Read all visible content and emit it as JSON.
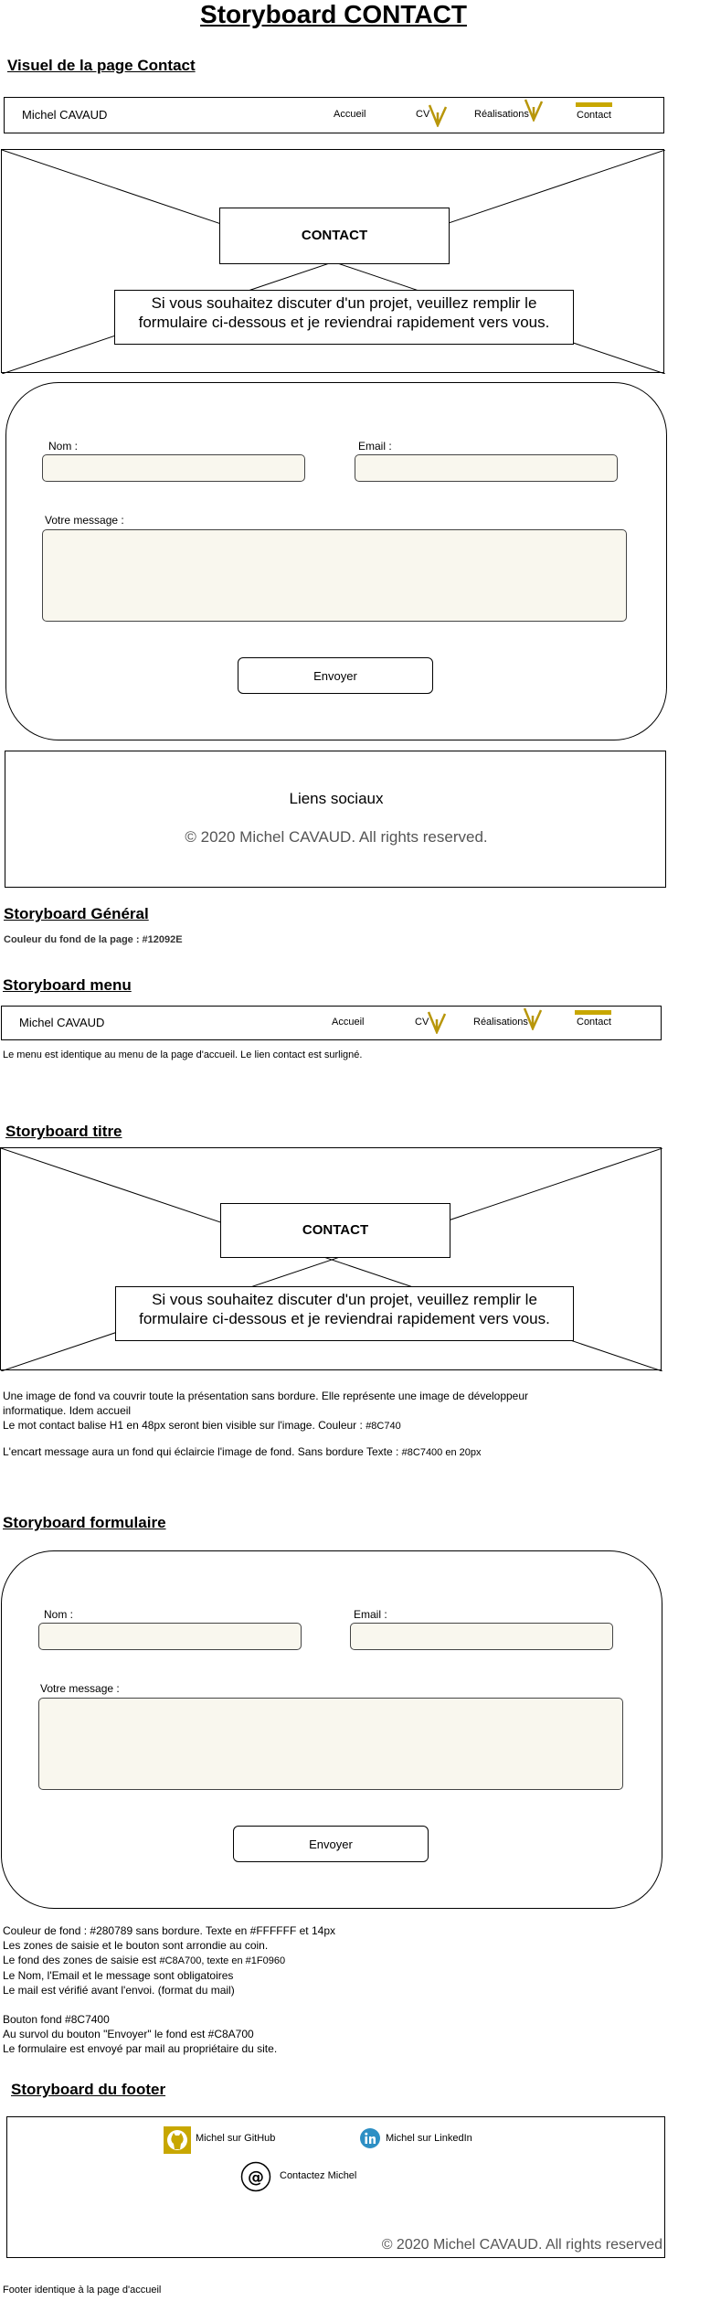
{
  "page_title": "Storyboard CONTACT",
  "sections": {
    "visuel": "Visuel de la page Contact",
    "general": "Storyboard Général",
    "menu": "Storyboard menu",
    "titre": "Storyboard titre",
    "formulaire": "Storyboard formulaire",
    "footer": "Storyboard du footer"
  },
  "menu": {
    "brand": "Michel CAVAUD",
    "links": [
      "Accueil",
      "CV",
      "Réalisations",
      "Contact"
    ],
    "active": "Contact",
    "accent_color": "#C8A700"
  },
  "hero": {
    "heading": "CONTACT",
    "message_line1": "Si vous souhaitez discuter d'un projet, veuillez remplir le",
    "message_line2": "formulaire ci-dessous et je reviendrai rapidement vers vous."
  },
  "form": {
    "nom_label": "Nom :",
    "email_label": "Email :",
    "message_label": "Votre message :",
    "submit_label": "Envoyer",
    "field_color": "#F9F7EE"
  },
  "footer_preview": {
    "social": "Liens sociaux",
    "copyright": "© 2020 Michel CAVAUD. All rights reserved."
  },
  "general_note": "Couleur du fond de la page : #12092E",
  "menu_note": "Le menu est identique au menu de la page d'accueil. Le lien contact est surligné.",
  "titre_notes": {
    "line1": "Une image de fond va couvrir toute la présentation sans bordure. Elle représente une image de développeur",
    "line2": "informatique. Idem accueil",
    "line3_main": "Le mot contact balise H1 en 48px seront bien visible sur l'image. Couleur :",
    "line3_small": "#8C740",
    "line4_main": "L'encart message aura un fond qui éclaircie l'image de fond. Sans bordure Texte :",
    "line4_small": "#8C7400 en 20px"
  },
  "form_notes": {
    "line1": "Couleur de fond : #280789 sans bordure. Texte en #FFFFFF et 14px",
    "line2": "Les zones de saisie et le bouton sont arrondie au coin.",
    "line3_main": "Le fond des zones de saisie est",
    "line3_small": "#C8A700, texte en #1F0960",
    "line4": "Le Nom, l'Email et le message sont obligatoires",
    "line5": "Le mail est vérifié avant l'envoi. (format du mail)",
    "line6": "Bouton fond #8C7400",
    "line7": "Au survol du bouton \"Envoyer\" le fond est #C8A700",
    "line8": "Le formulaire est envoyé par mail au propriétaire du site."
  },
  "footer_block": {
    "github": "Michel sur GitHub",
    "linkedin": "Michel sur LinkedIn",
    "contact": "Contactez Michel",
    "copyright": "© 2020 Michel CAVAUD. All rights reserved",
    "github_color": "#C8A700",
    "linkedin_color": "#2D8FC4"
  },
  "footer_note": "Footer identique à la page d'accueil"
}
